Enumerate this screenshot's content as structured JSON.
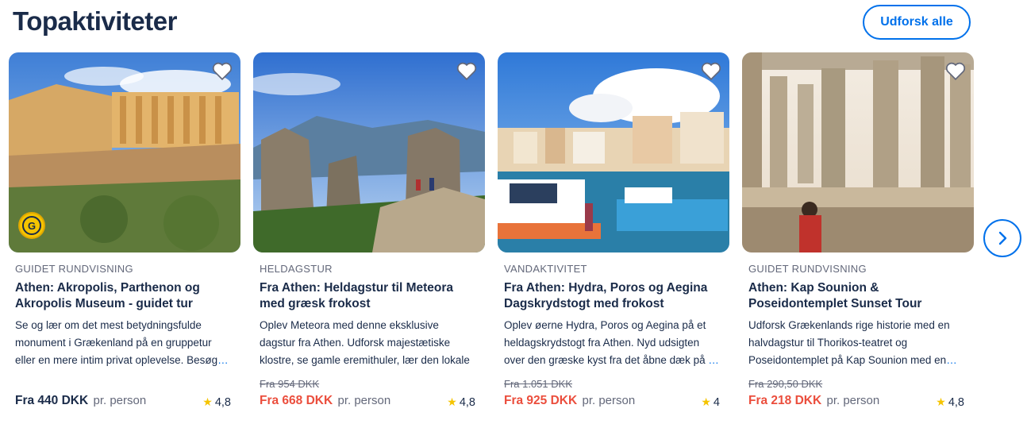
{
  "header": {
    "title": "Topaktiviteter",
    "explore_label": "Udforsk alle"
  },
  "cards": [
    {
      "category": "GUIDET RUNDVISNING",
      "title": "Athen: Akropolis, Parthenon og Akropolis Museum - guidet tur",
      "description": "Se og lær om det mest betydningsfulde monument i Grækenland på en gruppetur eller en mere intim privat oplevelse. Besøg",
      "old_price": "",
      "price": "Fra 440 DKK",
      "per": "pr. person",
      "rating": "4,8",
      "badge": "G",
      "icons": [
        "heart-icon",
        "star-icon",
        "badge-icon"
      ]
    },
    {
      "category": "HELDAGSTUR",
      "title": "Fra Athen: Heldagstur til Meteora med græsk frokost",
      "description": "Oplev Meteora med denne eksklusive dagstur fra Athen. Udforsk majestætiske klostre, se gamle eremithuler, lær den lokale historie,",
      "old_price": "Fra 954 DKK",
      "price": "Fra 668 DKK",
      "per": "pr. person",
      "rating": "4,8",
      "icons": [
        "heart-icon",
        "star-icon"
      ]
    },
    {
      "category": "VANDAKTIVITET",
      "title": "Fra Athen: Hydra, Poros og Aegina Dagskrydstogt med frokost",
      "description": "Oplev øerne Hydra, Poros og Aegina på et heldagskrydstogt fra Athen. Nyd udsigten over den græske kyst fra det åbne dæk på",
      "old_price": "Fra 1.051 DKK",
      "price": "Fra 925 DKK",
      "per": "pr. person",
      "rating": "4",
      "icons": [
        "heart-icon",
        "star-icon"
      ]
    },
    {
      "category": "GUIDET RUNDVISNING",
      "title": "Athen: Kap Sounion & Poseidontemplet Sunset Tour",
      "description": "Udforsk Grækenlands rige historie med en halvdagstur til Thorikos-teatret og Poseidontemplet på Kap Sounion med en",
      "old_price": "Fra 290,50 DKK",
      "price": "Fra 218 DKK",
      "per": "pr. person",
      "rating": "4,8",
      "icons": [
        "heart-icon",
        "star-icon"
      ]
    }
  ],
  "nav": {
    "next_icon": "chevron-right-icon"
  },
  "colors": {
    "brand_blue": "#0071eb",
    "text_dark": "#1a2b49",
    "text_muted": "#63687a",
    "sale_red": "#eb4e3d",
    "star_yellow": "#f5c400"
  }
}
